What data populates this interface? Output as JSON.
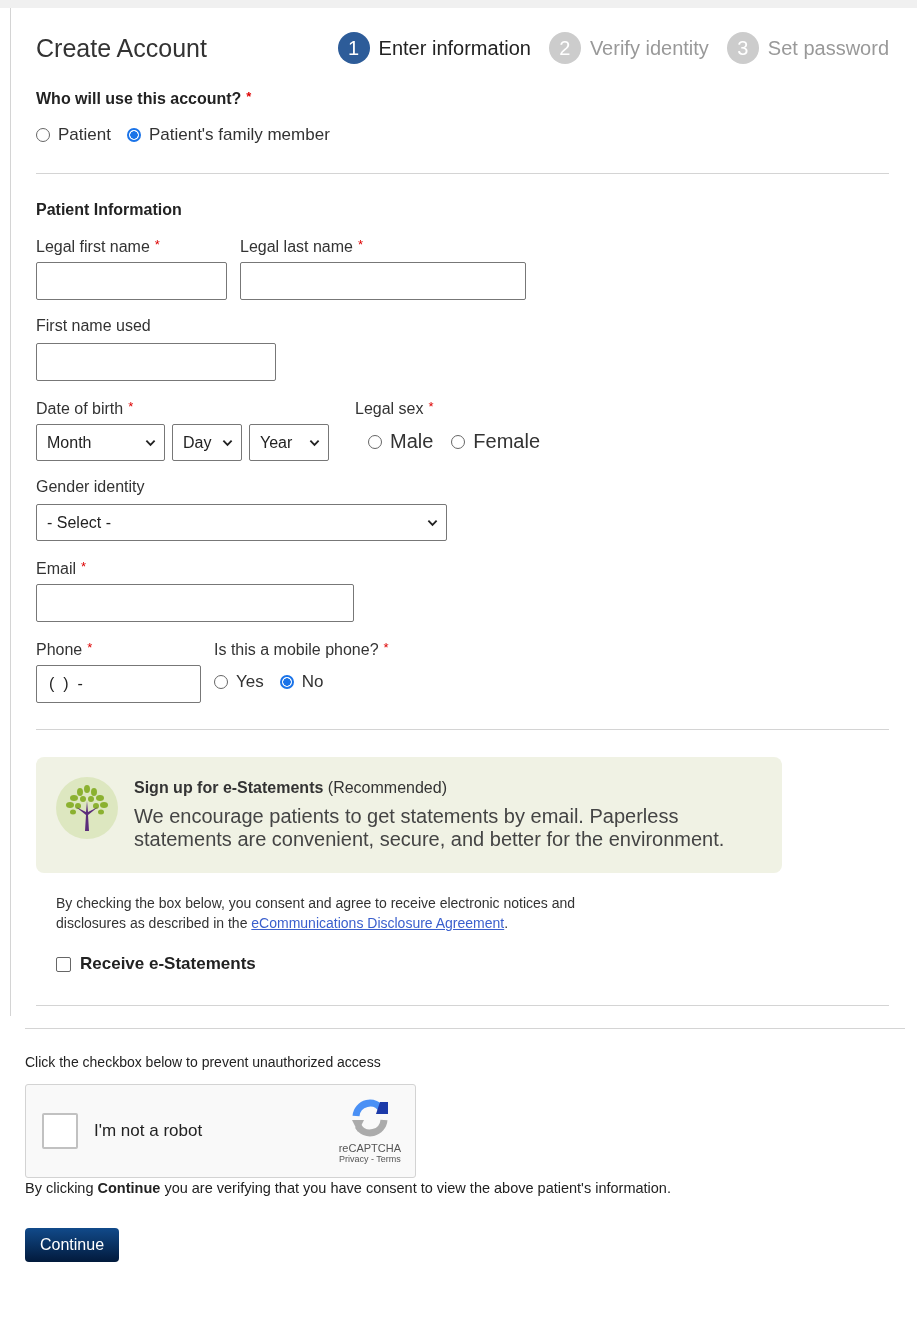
{
  "header": {
    "title": "Create Account",
    "steps": [
      {
        "number": "1",
        "label": "Enter information",
        "selected": true
      },
      {
        "number": "2",
        "label": "Verify identity",
        "selected": false
      },
      {
        "number": "3",
        "label": "Set password",
        "selected": false
      }
    ]
  },
  "account_user": {
    "label": "Who will use this account?",
    "required_mark": "*",
    "options": [
      {
        "label": "Patient",
        "selected": false
      },
      {
        "label": "Patient's family member",
        "selected": true
      }
    ]
  },
  "patient_info": {
    "heading": "Patient Information",
    "legal_first_name": {
      "label": "Legal first name",
      "required_mark": "*"
    },
    "legal_last_name": {
      "label": "Legal last name",
      "required_mark": "*"
    },
    "first_name_used": {
      "label": "First name used"
    },
    "date_of_birth": {
      "label": "Date of birth",
      "required_mark": "*",
      "selects": [
        "Month",
        "Day",
        "Year"
      ]
    },
    "legal_sex": {
      "label": "Legal sex",
      "required_mark": "*",
      "options": [
        {
          "label": "Male",
          "selected": false
        },
        {
          "label": "Female",
          "selected": false
        }
      ]
    },
    "gender_identity": {
      "label": "Gender identity",
      "select": "- Select -"
    },
    "email": {
      "label": "Email",
      "required_mark": "*"
    },
    "phone": {
      "label": "Phone",
      "required_mark": "*",
      "value": "(  )  -"
    },
    "mobile_phone": {
      "label": "Is this a mobile phone?",
      "required_mark": "*",
      "options": [
        {
          "label": "Yes",
          "selected": false
        },
        {
          "label": "No",
          "selected": true
        }
      ]
    }
  },
  "estatements": {
    "title": "Sign up for e-Statements",
    "note": "(Recommended)",
    "text": "We encourage patients to get statements by email. Paperless statements are convenient, secure, and better for the environment.",
    "consent": "By checking the box below, you consent and agree to receive electronic notices and disclosures as described in the ",
    "link": "eCommunications Disclosure Agreement",
    "consent_end": ".",
    "checkbox": {
      "label": "Receive e-Statements",
      "checked": false
    }
  },
  "captcha": {
    "instruction": "Click the checkbox below to prevent unauthorized access",
    "label": "I'm not a robot",
    "checked": false,
    "brand": "reCAPTCHA",
    "privacy": "Privacy",
    "separator": "-",
    "terms": "Terms"
  },
  "consent_notice": "By clicking **Continue** you are verifying that you have consent to view the above patient's information.",
  "button": "Continue"
}
